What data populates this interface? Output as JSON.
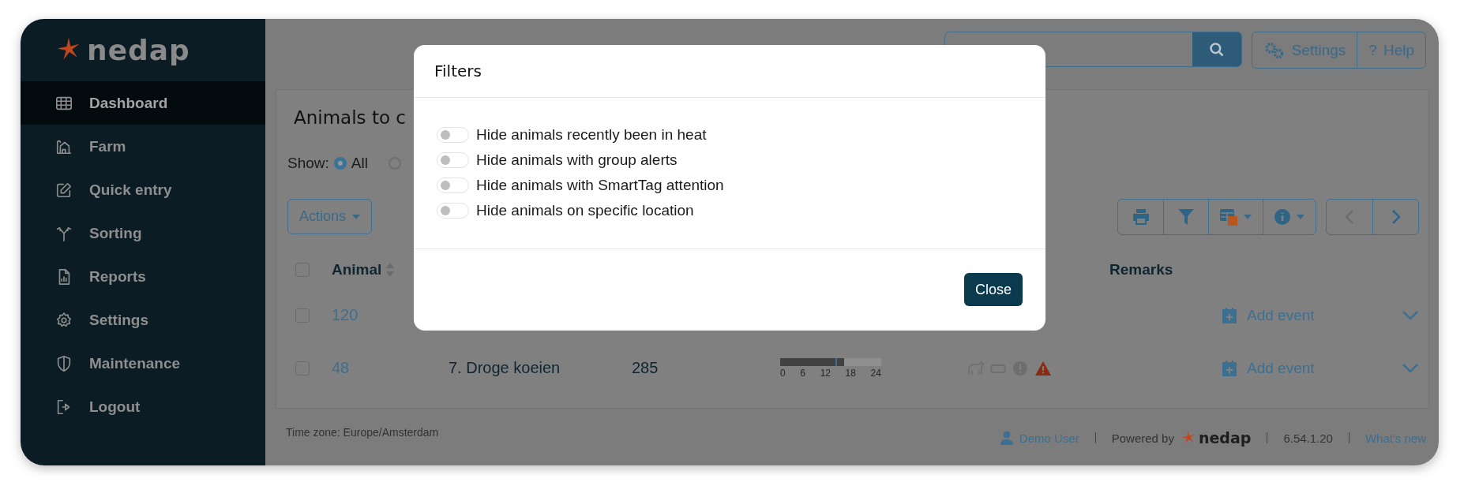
{
  "sidebar": {
    "logo": "nedap",
    "items": [
      {
        "label": "Dashboard",
        "selected": true
      },
      {
        "label": "Farm",
        "selected": false
      },
      {
        "label": "Quick entry",
        "selected": false
      },
      {
        "label": "Sorting",
        "selected": false
      },
      {
        "label": "Reports",
        "selected": false
      },
      {
        "label": "Settings",
        "selected": false
      },
      {
        "label": "Maintenance",
        "selected": false
      },
      {
        "label": "Logout",
        "selected": false
      }
    ]
  },
  "topbar": {
    "settings": "Settings",
    "help_icon": "?",
    "help": "Help"
  },
  "panel": {
    "title": "Animals to c",
    "show_label": "Show:",
    "show_options": [
      {
        "label": "All",
        "selected": true
      },
      {
        "selected": false
      }
    ],
    "actions": "Actions",
    "pager": {
      "previous": {
        "disabled": true
      },
      "next": {
        "disabled": false
      }
    }
  },
  "table": {
    "header_checked": false,
    "columns": [
      {
        "label": "Animal",
        "sortable": true
      },
      {
        "label": "Remarks",
        "sortable": false
      }
    ],
    "rows": [
      {
        "checked": false,
        "animal": "120",
        "action": "Add event"
      },
      {
        "checked": false,
        "animal": "48",
        "group": "7. Droge koeien",
        "days": "285",
        "timeline": {
          "level": 0.63,
          "marker": {
            "level": 0.55
          },
          "ticks": [
            "0",
            "6",
            "12",
            "18",
            "24"
          ]
        },
        "alerts": true,
        "action": "Add event"
      }
    ]
  },
  "footer": {
    "timezone": "Time zone: Europe/Amsterdam",
    "user": "Demo User",
    "powered_by": "Powered by",
    "logo": "nedap",
    "version": "6.54.1.20",
    "whats_new": "What's new"
  },
  "modal": {
    "title": "Filters",
    "switches": [
      {
        "label": "Hide animals recently been in heat",
        "on": false
      },
      {
        "label": "Hide animals with group alerts",
        "on": false
      },
      {
        "label": "Hide animals with SmartTag attention",
        "on": false
      },
      {
        "label": "Hide animals on specific location",
        "on": false
      }
    ],
    "close": "Close"
  }
}
